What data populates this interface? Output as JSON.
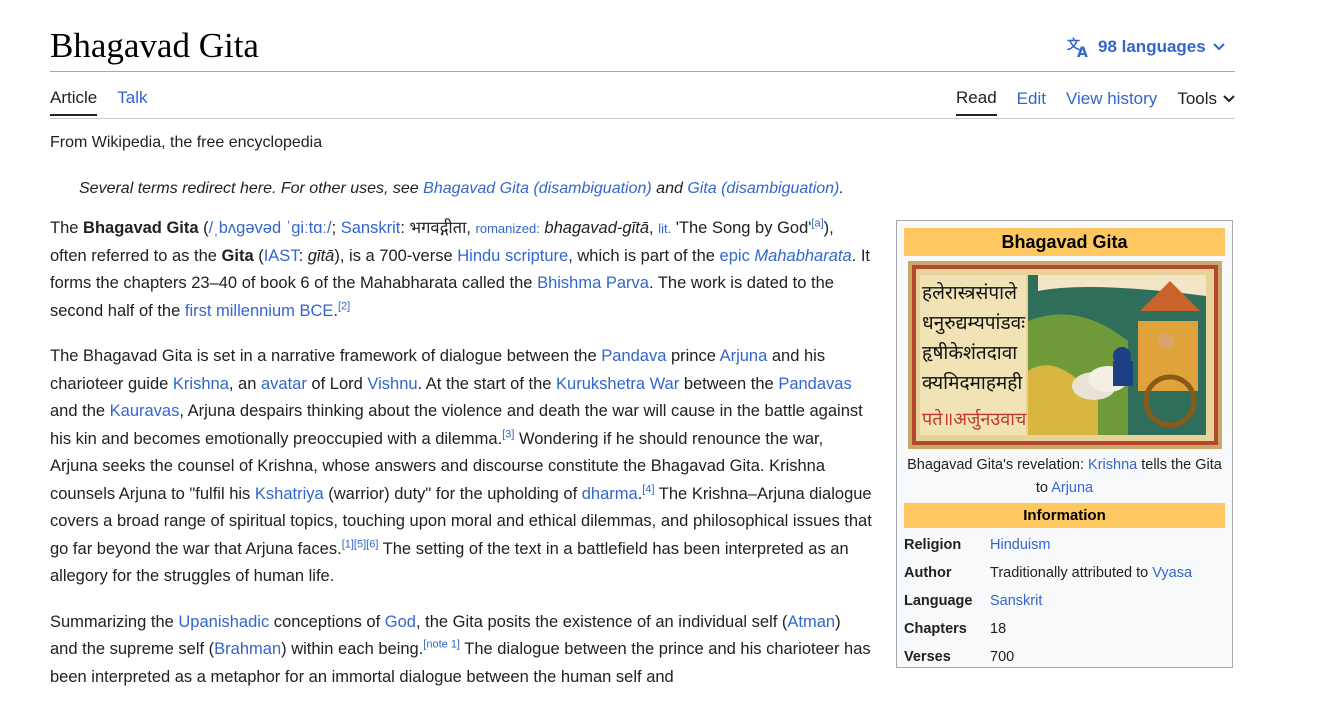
{
  "header": {
    "title": "Bhagavad Gita",
    "languages_label": "98 languages"
  },
  "tabs": {
    "left": [
      "Article",
      "Talk"
    ],
    "right": [
      "Read",
      "Edit",
      "View history",
      "Tools"
    ]
  },
  "tagline": "From Wikipedia, the free encyclopedia",
  "hatnote": {
    "prefix": "Several terms redirect here. For other uses, see ",
    "link1": "Bhagavad Gita (disambiguation)",
    "middle": " and ",
    "link2": "Gita (disambiguation)",
    "suffix": "."
  },
  "para1": {
    "t1": "The ",
    "b1": "Bhagavad Gita",
    "t2": " (",
    "ipa": "/ˌbʌɡəvəd ˈɡiːtɑː/",
    "t3": "; ",
    "sanskrit": "Sanskrit",
    "t4": ": भगवद्गीता, ",
    "romanized": "romanized:",
    "t5": " ",
    "i1": "bhagavad-gītā",
    "t6": ", ",
    "lit": "lit.",
    "t7": " 'The Song by God'",
    "ref_a": "[a]",
    "t8": "), often referred to as the ",
    "b2": "Gita",
    "t9": " (",
    "iast": "IAST",
    "t10": ": ",
    "i2": "gītā",
    "t11": "), is a 700-verse ",
    "hindu_scripture": "Hindu scripture",
    "t12": ", which is part of the ",
    "epic": "epic",
    "t13": " ",
    "mahabharata": "Mahabharata",
    "t14": ". It forms the chapters 23–40 of book 6 of the Mahabharata called the ",
    "bhishma": "Bhishma Parva",
    "t15": ". The work is dated to the second half of the ",
    "first_mill": "first millennium BCE",
    "t16": ".",
    "ref2": "[2]"
  },
  "para2": {
    "t1": "The Bhagavad Gita is set in a narrative framework of dialogue between the ",
    "pandava": "Pandava",
    "t2": " prince ",
    "arjuna": "Arjuna",
    "t3": " and his charioteer guide ",
    "krishna": "Krishna",
    "t4": ", an ",
    "avatar": "avatar",
    "t5": " of Lord ",
    "vishnu": "Vishnu",
    "t6": ". At the start of the ",
    "kurukshetra": "Kurukshetra War",
    "t7": " between the ",
    "pandavas": "Pandavas",
    "t8": " and the ",
    "kauravas": "Kauravas",
    "t9": ", Arjuna despairs thinking about the violence and death the war will cause in the battle against his kin and becomes emotionally preoccupied with a dilemma.",
    "ref3": "[3]",
    "t10": " Wondering if he should renounce the war, Arjuna seeks the counsel of Krishna, whose answers and discourse constitute the Bhagavad Gita. Krishna counsels Arjuna to \"fulfil his ",
    "kshatriya": "Kshatriya",
    "t11": " (warrior) duty\" for the upholding of ",
    "dharma": "dharma",
    "t12": ".",
    "ref4": "[4]",
    "t13": " The Krishna–Arjuna dialogue covers a broad range of spiritual topics, touching upon moral and ethical dilemmas, and philosophical issues that go far beyond the war that Arjuna faces.",
    "ref156": "[1][5][6]",
    "t14": " The setting of the text in a battlefield has been interpreted as an allegory for the struggles of human life."
  },
  "para3": {
    "t1": "Summarizing the ",
    "upanishadic": "Upanishadic",
    "t2": " conceptions of ",
    "god": "God",
    "t3": ", the Gita posits the existence of an individual self (",
    "atman": "Atman",
    "t4": ") and the supreme self (",
    "brahman": "Brahman",
    "t5": ") within each being.",
    "note1": "[note 1]",
    "t6": " The dialogue between the prince and his charioteer has been interpreted as a metaphor for an immortal dialogue between the human self and"
  },
  "infobox": {
    "title": "Bhagavad Gita",
    "caption_t1": "Bhagavad Gita's revelation: ",
    "caption_krishna": "Krishna",
    "caption_t2": " tells the Gita to ",
    "caption_arjuna": "Arjuna",
    "section": "Information",
    "image_text": [
      "हलेरास्त्रसंपाले",
      "धनुरुद्यम्यपांडवः",
      "हृषीकेशंतदावा",
      "क्यमिदमाहमही",
      "पते॥अर्जुनउवाच"
    ],
    "rows": [
      {
        "label": "Religion",
        "value": "Hinduism",
        "link": true
      },
      {
        "label": "Author",
        "value_prefix": "Traditionally attributed to ",
        "value": "Vyasa",
        "link": true
      },
      {
        "label": "Language",
        "value": "Sanskrit",
        "link": true
      },
      {
        "label": "Chapters",
        "value": "18",
        "link": false
      },
      {
        "label": "Verses",
        "value": "700",
        "link": false
      }
    ]
  },
  "colors": {
    "link": "#3366cc",
    "infobox_header": "#ffc760",
    "text": "#202122"
  }
}
